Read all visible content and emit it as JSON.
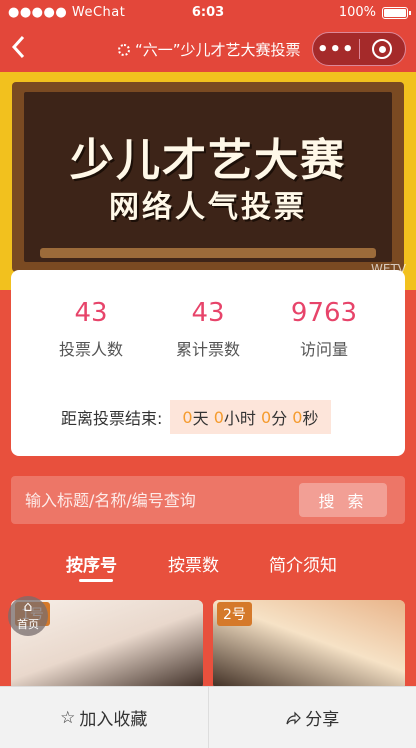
{
  "status_bar": {
    "carrier": "●●●●● WeChat",
    "wifi_icon": "wifi-icon",
    "time": "6:03",
    "battery": "100%"
  },
  "nav": {
    "back_icon": "chevron-left-icon",
    "title": "“六一”少儿才艺大赛投票",
    "more_label": "•••",
    "colors": {
      "bar": "#e3473a"
    }
  },
  "banner": {
    "title": "少儿才艺大赛",
    "subtitle": "网络人气投票",
    "watermark": "WETV"
  },
  "stats": [
    {
      "value": "43",
      "label": "投票人数"
    },
    {
      "value": "43",
      "label": "累计票数"
    },
    {
      "value": "9763",
      "label": "访问量"
    }
  ],
  "countdown": {
    "label": "距离投票结束:",
    "days": "0",
    "days_unit": "天",
    "hours": "0",
    "hours_unit": "小时",
    "minutes": "0",
    "minutes_unit": "分",
    "seconds": "0",
    "seconds_unit": "秒"
  },
  "search": {
    "placeholder": "输入标题/名称/编号查询",
    "button": "搜 索"
  },
  "tabs": [
    {
      "label": "按序号",
      "active": true
    },
    {
      "label": "按票数",
      "active": false
    },
    {
      "label": "简介须知",
      "active": false
    }
  ],
  "entries": [
    {
      "badge": "1号"
    },
    {
      "badge": "2号"
    }
  ],
  "home_button": {
    "label": "首页"
  },
  "bottom_bar": {
    "favorite": "加入收藏",
    "share": "分享"
  },
  "colors": {
    "accent": "#e8503d",
    "number": "#e7446a",
    "countdown_number": "#f59b2e"
  }
}
